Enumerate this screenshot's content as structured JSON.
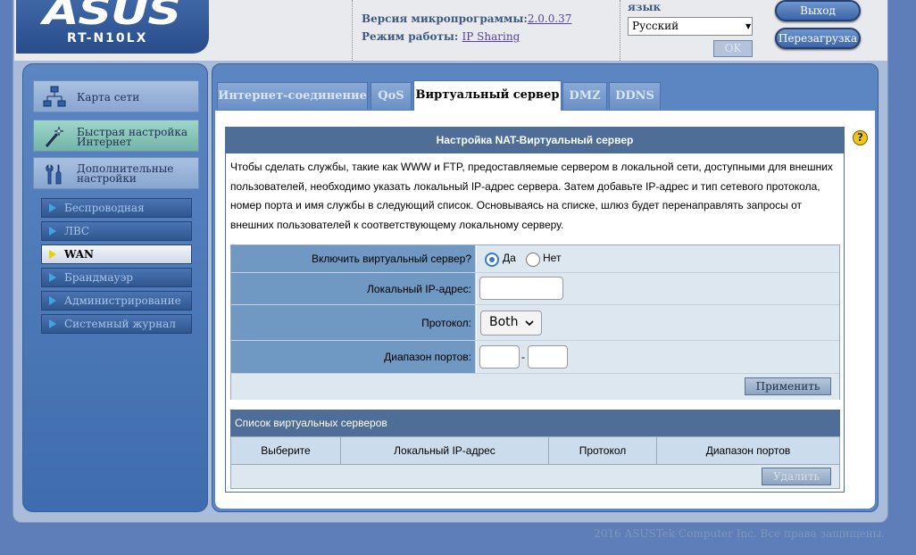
{
  "header": {
    "logo": "ASUS",
    "model": "RT-N10LX",
    "firmware_label": "Версия микропрограммы:",
    "firmware_value": "2.0.0.37",
    "mode_label": "Режим работы:",
    "mode_value": "IP Sharing",
    "language_label": "язык",
    "language_value": "Русский",
    "ok_label": "OK",
    "logout_label": "Выход",
    "reboot_label": "Перезагрузка"
  },
  "sidebar": {
    "big_items": [
      {
        "label_1": "Карта сети",
        "label_2": ""
      },
      {
        "label_1": "Быстрая настройка",
        "label_2": "Интернет"
      },
      {
        "label_1": "Дополнительные",
        "label_2": "настройки"
      }
    ],
    "sub_items": [
      {
        "label": "Беспроводная"
      },
      {
        "label": "ЛВС"
      },
      {
        "label": "WAN"
      },
      {
        "label": "Брандмауэр"
      },
      {
        "label": "Администрирование"
      },
      {
        "label": "Системный журнал"
      }
    ]
  },
  "tabs": [
    {
      "label": "Интернет-соединение"
    },
    {
      "label": "QoS"
    },
    {
      "label": "Виртуальный сервер"
    },
    {
      "label": "DMZ"
    },
    {
      "label": "DDNS"
    }
  ],
  "nat": {
    "title": "Настройка NAT-Виртуальный сервер",
    "description": "Чтобы сделать службы, такие как WWW и FTP, предоставляемые сервером в локальной сети, доступными для внешних пользователей, необходимо указать локальный IP-адрес сервера. Затем добавьте IP-адрес и тип сетевого протокола, номер порта и имя службы в следующий список. Основываясь на списке, шлюз будет перенаправлять запросы от внешних пользователей к соответствующему локальному серверу.",
    "enable_label": "Включить виртуальный сервер?",
    "yes_label": "Да",
    "no_label": "Нет",
    "local_ip_label": "Локальный IP-адрес:",
    "local_ip_value": "",
    "protocol_label": "Протокол:",
    "protocol_value": "Both",
    "port_range_label": "Диапазон портов:",
    "port_separator": "-",
    "port_from": "",
    "port_to": "",
    "apply_label": "Применить"
  },
  "list": {
    "title": "Список виртуальных серверов",
    "columns": [
      "Выберите",
      "Локальный IP-адрес",
      "Протокол",
      "Диапазон портов"
    ],
    "delete_label": "Удалить"
  },
  "footer": "2016 ASUSTek Computer Inc. Все права защищены."
}
